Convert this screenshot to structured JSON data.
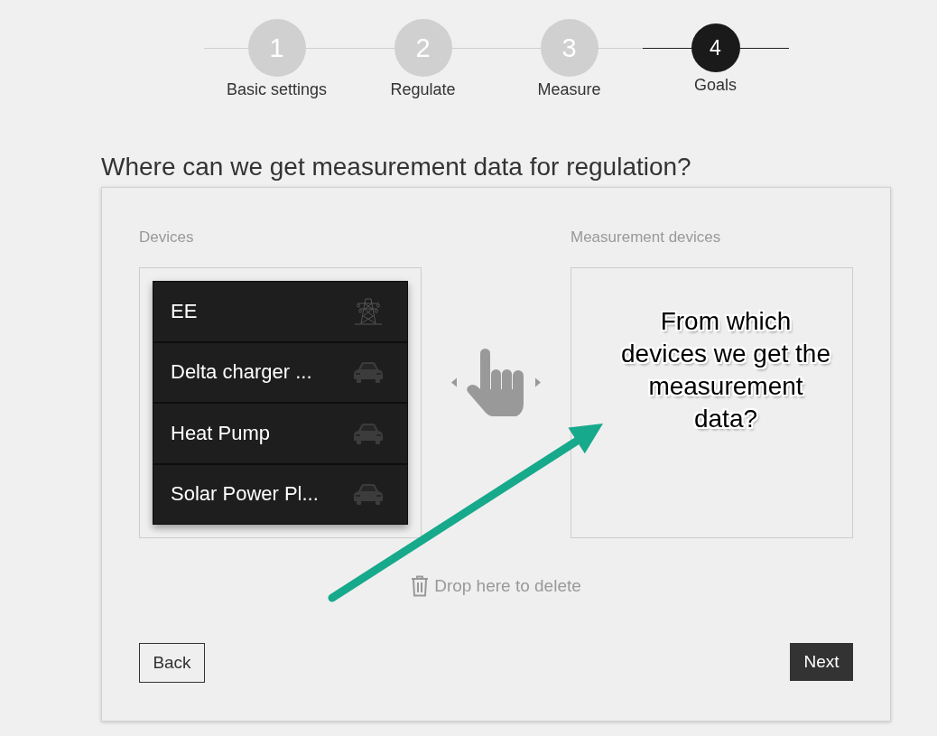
{
  "steps": [
    {
      "number": "1",
      "label": "Basic settings",
      "selected": false
    },
    {
      "number": "2",
      "label": "Regulate",
      "selected": false
    },
    {
      "number": "3",
      "label": "Measure",
      "selected": false
    },
    {
      "number": "4",
      "label": "Goals",
      "selected": true
    }
  ],
  "heading": "Where can we get measurement data for regulation?",
  "devices": {
    "label": "Devices",
    "items": [
      {
        "name": "EE",
        "kind": "pylon"
      },
      {
        "name": "Delta charger ...",
        "kind": "car"
      },
      {
        "name": "Heat Pump",
        "kind": "car"
      },
      {
        "name": "Solar Power Pl...",
        "kind": "car"
      }
    ]
  },
  "measurement_devices": {
    "label": "Measurement devices"
  },
  "delete_zone": {
    "label": "Drop here to delete"
  },
  "buttons": {
    "back": "Back",
    "next": "Next"
  },
  "annotation": {
    "text": "From which\ndevices we get the\nmeasurement\ndata?"
  }
}
